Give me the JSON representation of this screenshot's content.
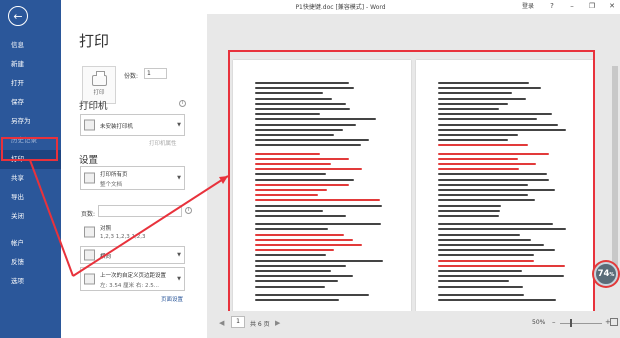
{
  "window": {
    "title": "P1快捷键.doc [兼容模式] - Word",
    "login": "登录",
    "help": "?",
    "minimize": "–",
    "restore": "❐",
    "close": "✕"
  },
  "sidebar": {
    "back_icon": "arrow-left-icon",
    "items": [
      {
        "label": "信息",
        "state": "normal"
      },
      {
        "label": "新建",
        "state": "normal"
      },
      {
        "label": "打开",
        "state": "normal"
      },
      {
        "label": "保存",
        "state": "normal"
      },
      {
        "label": "另存为",
        "state": "normal"
      },
      {
        "label": "历史记录",
        "state": "disabled"
      },
      {
        "label": "打印",
        "state": "active"
      },
      {
        "label": "共享",
        "state": "normal"
      },
      {
        "label": "导出",
        "state": "normal"
      },
      {
        "label": "关闭",
        "state": "normal"
      },
      {
        "label": "帐户",
        "state": "normal"
      },
      {
        "label": "反馈",
        "state": "normal"
      },
      {
        "label": "选项",
        "state": "normal"
      }
    ]
  },
  "print_panel": {
    "heading": "打印",
    "print_button_label": "打印",
    "copies_label": "份数:",
    "copies_value": "1",
    "printer": {
      "heading": "打印机",
      "name": "未安装打印机",
      "properties_link": "打印机属性"
    },
    "settings": {
      "heading": "设置",
      "print_all": {
        "title": "打印所有页",
        "subtitle": "整个文档"
      },
      "pages_label": "页数:",
      "pages_value": "",
      "collate": {
        "title": "对照",
        "subtitle": "1,2,3    1,2,3    1,2,3"
      },
      "orientation": {
        "title": "横向"
      },
      "margins": {
        "title": "上一次的自定义页边距设置",
        "subtitle": "左: 3.54 厘米    右: 2.5..."
      },
      "page_setup_link": "页面设置"
    }
  },
  "preview": {
    "current_page": "1",
    "page_count_text": "共 6 页",
    "zoom_text": "50%",
    "zoom_percent": 50,
    "prev_icon": "chevron-left-icon",
    "next_icon": "chevron-right-icon"
  },
  "overlay": {
    "badge_text": "74",
    "badge_unit": "%"
  },
  "colors": {
    "sidebar": "#2b579a",
    "sidebar_active": "#1e4480",
    "annotation_red": "#e8323c",
    "preview_bg": "#e8e8e8"
  }
}
